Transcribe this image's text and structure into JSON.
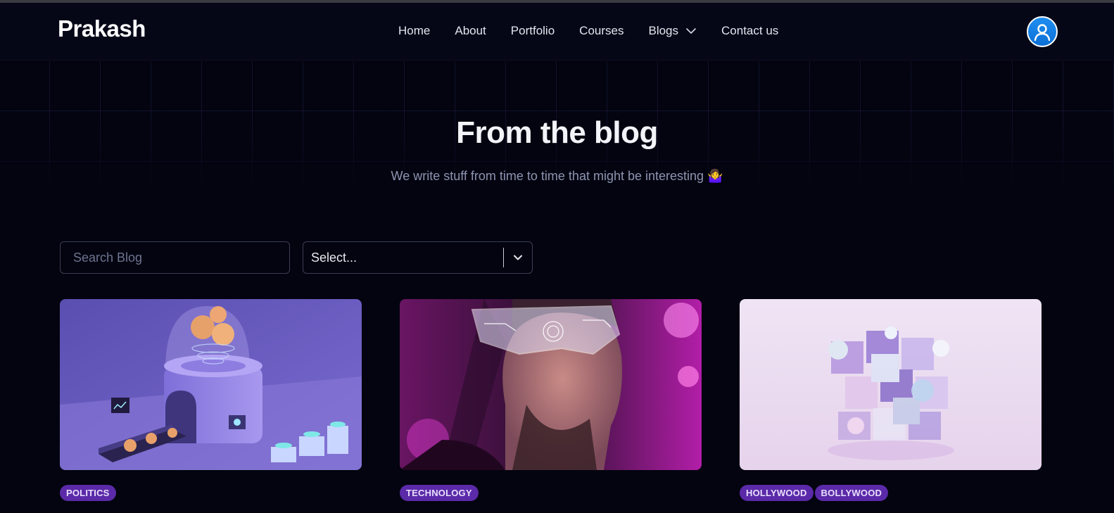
{
  "brand": {
    "name": "Prakash"
  },
  "nav": {
    "items": [
      {
        "label": "Home"
      },
      {
        "label": "About"
      },
      {
        "label": "Portfolio"
      },
      {
        "label": "Courses"
      },
      {
        "label": "Blogs",
        "icon": "chevron-down-icon"
      },
      {
        "label": "Contact us"
      }
    ]
  },
  "profile": {
    "icon": "user-icon"
  },
  "hero": {
    "title": "From the blog",
    "subtitle": "We write stuff from time to time that might be interesting 🤷‍♀️"
  },
  "filters": {
    "search_placeholder": "Search Blog",
    "search_value": "",
    "select_value": "Select..."
  },
  "posts": [
    {
      "image": "crypto-machine-illustration",
      "tags": [
        "POLITICS"
      ]
    },
    {
      "image": "man-with-futuristic-glasses",
      "tags": [
        "TECHNOLOGY"
      ]
    },
    {
      "image": "glass-cubes-render",
      "tags": [
        "HOLLYWOOD",
        "BOLLYWOOD"
      ]
    }
  ],
  "colors": {
    "background": "#03040f",
    "tag_bg": "#5b2aa8",
    "avatar_blue": "#1f8ef1"
  }
}
